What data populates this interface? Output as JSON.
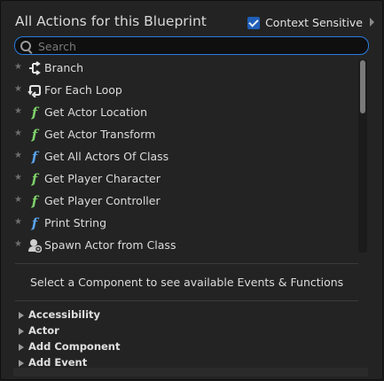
{
  "header": {
    "title": "All Actions for this Blueprint",
    "context_sensitive_label": "Context Sensitive",
    "context_sensitive_checked": true
  },
  "search": {
    "placeholder": "Search",
    "value": ""
  },
  "actions": [
    {
      "label": "Branch",
      "icon": "branch-icon"
    },
    {
      "label": "For Each Loop",
      "icon": "loop-icon"
    },
    {
      "label": "Get Actor Location",
      "icon": "pure-function-icon"
    },
    {
      "label": "Get Actor Transform",
      "icon": "pure-function-icon"
    },
    {
      "label": "Get All Actors Of Class",
      "icon": "function-icon"
    },
    {
      "label": "Get Player Character",
      "icon": "pure-function-icon"
    },
    {
      "label": "Get Player Controller",
      "icon": "pure-function-icon"
    },
    {
      "label": "Print String",
      "icon": "function-icon"
    },
    {
      "label": "Spawn Actor from Class",
      "icon": "spawn-actor-icon"
    }
  ],
  "hint": "Select a Component to see available Events & Functions",
  "categories": [
    {
      "label": "Accessibility"
    },
    {
      "label": "Actor"
    },
    {
      "label": "Add Component"
    },
    {
      "label": "Add Event"
    }
  ],
  "colors": {
    "accent": "#2a7be0",
    "pure_function": "#7fd26a",
    "function": "#5aa5ee",
    "panel_bg": "#232323"
  }
}
